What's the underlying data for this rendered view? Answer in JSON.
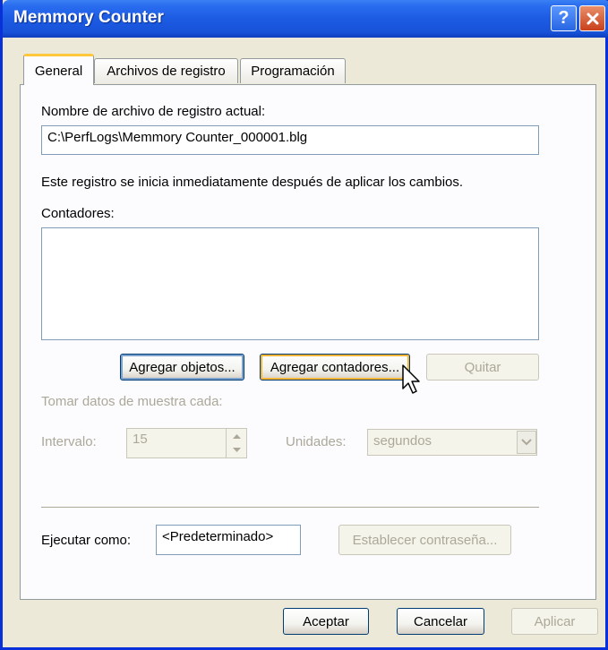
{
  "window": {
    "title": "Memmory Counter",
    "help_label": "?"
  },
  "tabs": [
    {
      "label": "General",
      "active": true
    },
    {
      "label": "Archivos de registro",
      "active": false
    },
    {
      "label": "Programación",
      "active": false
    }
  ],
  "general": {
    "filename_label": "Nombre de archivo de registro actual:",
    "filename_value": "C:\\PerfLogs\\Memmory Counter_000001.blg",
    "info_text": "Este registro se inicia inmediatamente después de aplicar los cambios.",
    "counters_label": "Contadores:",
    "counters": [],
    "add_objects_label": "Agregar objetos...",
    "add_counters_label": "Agregar contadores...",
    "remove_label": "Quitar",
    "sample_label": "Tomar datos de muestra cada:",
    "interval_label": "Intervalo:",
    "interval_value": "15",
    "units_label": "Unidades:",
    "units_value": "segundos",
    "run_as_label": "Ejecutar como:",
    "run_as_value": "<Predeterminado>",
    "set_password_label": "Establecer contraseña..."
  },
  "footer": {
    "ok_label": "Aceptar",
    "cancel_label": "Cancelar",
    "apply_label": "Aplicar"
  },
  "colors": {
    "titlebar": "#1c5be3",
    "dialog_bg": "#ece9d8",
    "panel_bg": "#fcfcfe",
    "disabled_text": "#aca899",
    "active_tab_accent": "#ffc83c"
  },
  "icons": [
    "help-icon",
    "close-icon",
    "spin-up-icon",
    "spin-down-icon",
    "chevron-down-icon",
    "mouse-cursor-icon"
  ]
}
